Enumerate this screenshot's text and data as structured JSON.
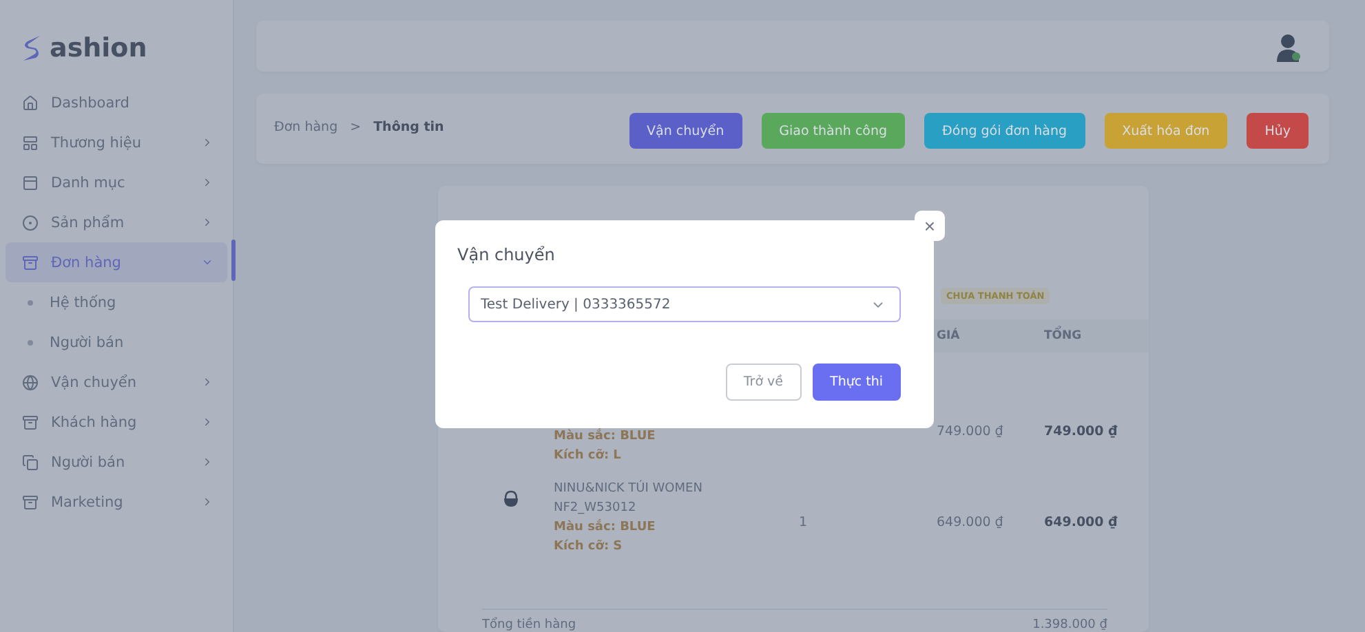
{
  "brand": {
    "name": "ashion"
  },
  "sidebar": {
    "items": [
      {
        "label": "Dashboard",
        "kind": "link",
        "selected": false
      },
      {
        "label": "Thương hiệu",
        "kind": "group",
        "selected": false,
        "expanded": false
      },
      {
        "label": "Danh mục",
        "kind": "group",
        "selected": false,
        "expanded": false
      },
      {
        "label": "Sản phẩm",
        "kind": "group",
        "selected": false,
        "expanded": false
      },
      {
        "label": "Đơn hàng",
        "kind": "group",
        "selected": true,
        "expanded": true,
        "children": [
          {
            "label": "Hệ thống",
            "selected": false
          },
          {
            "label": "Người bán",
            "selected": false
          }
        ]
      },
      {
        "label": "Vận chuyển",
        "kind": "group",
        "selected": false,
        "expanded": false
      },
      {
        "label": "Khách hàng",
        "kind": "group",
        "selected": false,
        "expanded": false
      },
      {
        "label": "Người bán",
        "kind": "group",
        "selected": false,
        "expanded": false
      },
      {
        "label": "Marketing",
        "kind": "group",
        "selected": false,
        "expanded": false
      }
    ]
  },
  "header": {
    "user": {
      "online": true
    }
  },
  "breadcrumb": [
    "Đơn hàng",
    "Thông tin"
  ],
  "breadcrumb_separator": ">",
  "actions": [
    {
      "label": "Vận chuyển",
      "color": "#5a60c8"
    },
    {
      "label": "Giao thành công",
      "color": "#5aa85c"
    },
    {
      "label": "Đóng gói đơn hàng",
      "color": "#2a9fc4"
    },
    {
      "label": "Xuất hóa đơn",
      "color": "#c9a235"
    },
    {
      "label": "Hủy",
      "color": "#c44a4a"
    }
  ],
  "order": {
    "payment_status": "CHƯA THANH TOÁN",
    "table": {
      "columns": [
        "GIÁ",
        "TỔNG"
      ],
      "rows": [
        {
          "variant_lines": [
            "Màu sắc: BLUE",
            "Kích cỡ: L"
          ],
          "price": "749.000 ₫",
          "total": "749.000 ₫"
        },
        {
          "image": true,
          "name": "NINU&NICK TÚI WOMEN NF2_W53012",
          "variant_lines": [
            "Màu sắc: BLUE",
            "Kích cỡ: S"
          ],
          "quantity": "1",
          "price": "649.000 ₫",
          "total": "649.000 ₫"
        }
      ]
    },
    "summary": {
      "label": "Tổng tiền hàng",
      "value": "1.398.000 ₫"
    }
  },
  "modal": {
    "title": "Vận chuyển",
    "close": "×",
    "select": {
      "value": "Test Delivery | 0333365572"
    },
    "buttons": [
      {
        "label": "Trở về",
        "kind": "secondary"
      },
      {
        "label": "Thực thi",
        "kind": "primary"
      }
    ]
  }
}
